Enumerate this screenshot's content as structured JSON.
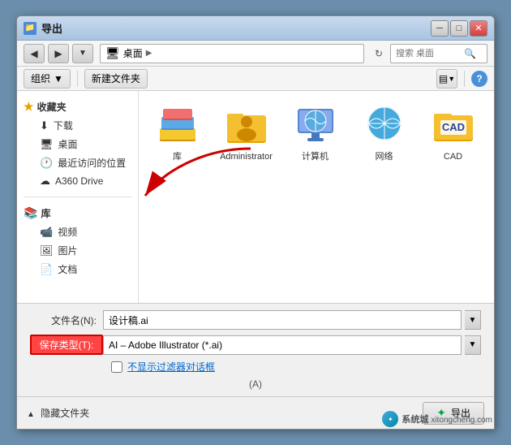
{
  "window": {
    "title": "导出",
    "title_icon": "📁"
  },
  "toolbar": {
    "back_btn": "◀",
    "forward_btn": "▶",
    "address": "桌面",
    "address_arrow": "▶",
    "refresh_icon": "↻",
    "search_placeholder": "搜索 桌面",
    "search_icon": "🔍"
  },
  "actionbar": {
    "organize_label": "组织",
    "organize_arrow": "▼",
    "new_folder_label": "新建文件夹",
    "view_icon": "☰",
    "help_icon": "?"
  },
  "sidebar": {
    "favorites_label": "收藏夹",
    "items": [
      {
        "label": "下载",
        "icon": "⬇"
      },
      {
        "label": "桌面",
        "icon": "🖥"
      },
      {
        "label": "最近访问的位置",
        "icon": "🕐"
      },
      {
        "label": "A360 Drive",
        "icon": "☁"
      }
    ],
    "library_label": "库",
    "library_items": [
      {
        "label": "视频",
        "icon": "📹"
      },
      {
        "label": "图片",
        "icon": "🖼"
      },
      {
        "label": "文档",
        "icon": "📄"
      }
    ]
  },
  "files": [
    {
      "name": "库",
      "type": "library"
    },
    {
      "name": "Administrator",
      "type": "user"
    },
    {
      "name": "计算机",
      "type": "computer"
    },
    {
      "name": "网络",
      "type": "network"
    },
    {
      "name": "CAD",
      "type": "cad"
    }
  ],
  "form": {
    "filename_label": "文件名(N):",
    "filename_value": "设计稿.ai",
    "filetype_label": "保存类型(T):",
    "filetype_value": "AI – Adobe Illustrator (*.ai)",
    "checkbox_label": "不显示过滤器对话框",
    "checkbox_sub": "(A)"
  },
  "bottom": {
    "hide_folders_label": "隐藏文件夹",
    "export_btn": "导出"
  },
  "watermark": {
    "text": "系统城",
    "site": "xitongcheng.com"
  }
}
